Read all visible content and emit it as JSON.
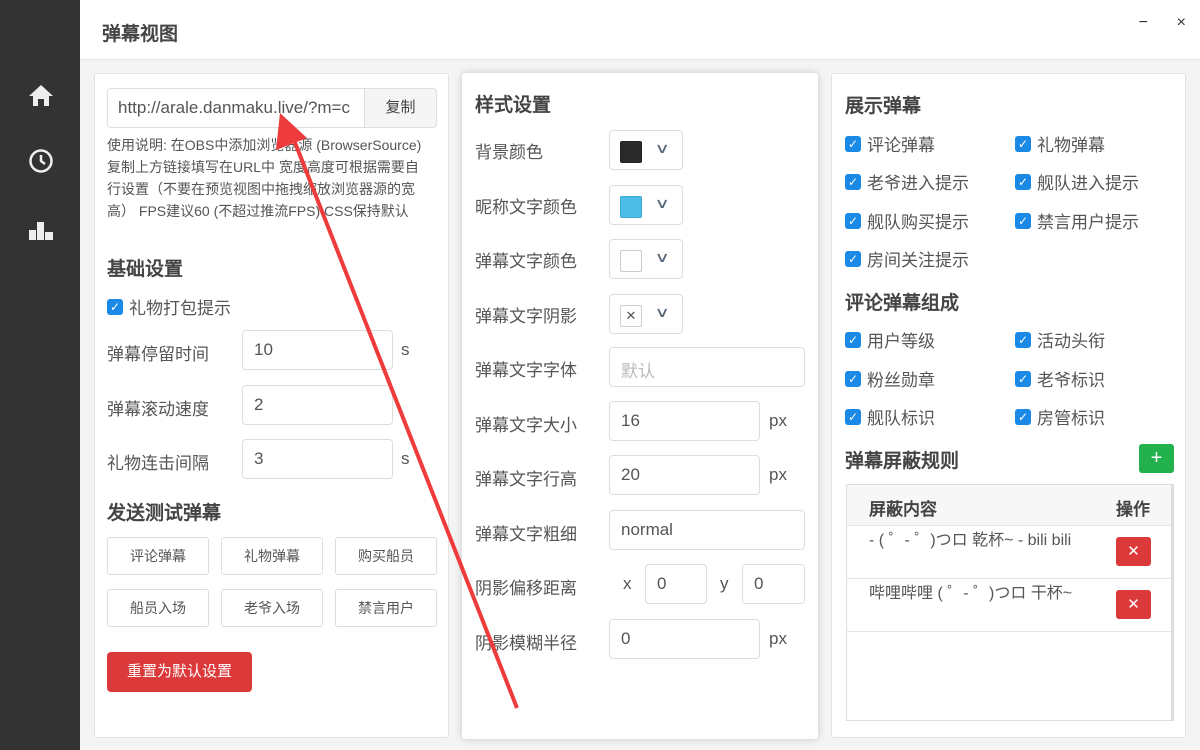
{
  "window": {
    "title": "弹幕视图",
    "minimize": "−",
    "close": "×"
  },
  "sidebar": {
    "items": [
      {
        "icon": "home-icon"
      },
      {
        "icon": "clock-icon"
      },
      {
        "icon": "bar-chart-icon"
      }
    ]
  },
  "left": {
    "url": "http://arale.danmaku.live/?m=c",
    "copy": "复制",
    "help": "使用说明: 在OBS中添加浏览器源 (BrowserSource) 复制上方链接填写在URL中 宽度高度可根据需要自行设置（不要在预览视图中拖拽缩放浏览器源的宽高） FPS建议60 (不超过推流FPS) CSS保持默认",
    "basic_title": "基础设置",
    "gift_pack": "礼物打包提示",
    "fields": [
      {
        "label": "弹幕停留时间",
        "value": "10",
        "unit": "s"
      },
      {
        "label": "弹幕滚动速度",
        "value": "2",
        "unit": ""
      },
      {
        "label": "礼物连击间隔",
        "value": "3",
        "unit": "s"
      }
    ],
    "test_title": "发送测试弹幕",
    "test_buttons": [
      "评论弹幕",
      "礼物弹幕",
      "购买船员",
      "船员入场",
      "老爷入场",
      "禁言用户"
    ],
    "reset": "重置为默认设置"
  },
  "middle": {
    "title": "样式设置",
    "colors": [
      {
        "label": "背景颜色",
        "color": "#2a2a2a"
      },
      {
        "label": "昵称文字颜色",
        "color": "#4dbde8"
      },
      {
        "label": "弹幕文字颜色",
        "color": "#ffffff"
      },
      {
        "label": "弹幕文字阴影",
        "color": "none"
      }
    ],
    "font_label": "弹幕文字字体",
    "font_placeholder": "默认",
    "size_label": "弹幕文字大小",
    "size": "16",
    "size_unit": "px",
    "line_label": "弹幕文字行高",
    "line": "20",
    "line_unit": "px",
    "weight_label": "弹幕文字粗细",
    "weight": "normal",
    "offset_label": "阴影偏移距离",
    "x_label": "x",
    "x": "0",
    "y_label": "y",
    "y": "0",
    "blur_label": "阴影模糊半径",
    "blur": "0",
    "blur_unit": "px"
  },
  "right": {
    "show_title": "展示弹幕",
    "show": [
      "评论弹幕",
      "礼物弹幕",
      "老爷进入提示",
      "舰队进入提示",
      "舰队购买提示",
      "禁言用户提示",
      "房间关注提示"
    ],
    "compose_title": "评论弹幕组成",
    "compose": [
      "用户等级",
      "活动头衔",
      "粉丝勋章",
      "老爷标识",
      "舰队标识",
      "房管标识"
    ],
    "block_title": "弹幕屏蔽规则",
    "add": "+",
    "table": {
      "headers": [
        "屏蔽内容",
        "操作"
      ],
      "rows": [
        {
          "content": "- ( ゜- ゜)つロ 乾杯~ - bili bili",
          "del": "✕"
        },
        {
          "content": "哔哩哔哩 ( ゜- ゜)つロ 干杯~",
          "del": "✕"
        }
      ]
    }
  }
}
